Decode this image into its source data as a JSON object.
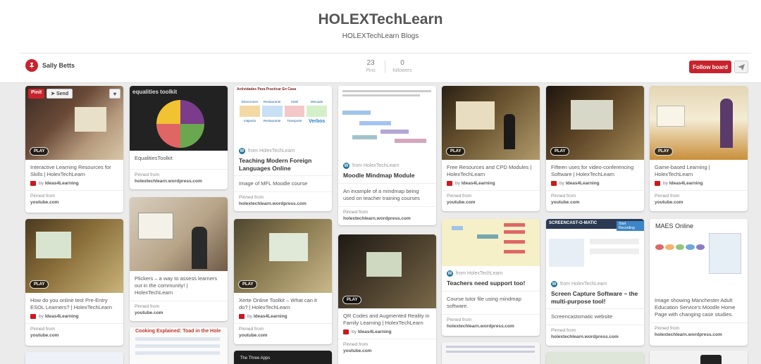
{
  "board": {
    "title": "HOLEXTechLearn",
    "subtitle": "HOLEXTechLearn Blogs",
    "owner": "Sally Betts",
    "pins_count": "23",
    "pins_label": "Pins",
    "followers_count": "0",
    "followers_label": "followers",
    "follow_label": "Follow board"
  },
  "pin_actions": {
    "pinit": "Pinit",
    "send": "Send",
    "like": "♥"
  },
  "play_label": "PLAY",
  "pinned_from_label": "Pinned from",
  "colors": {
    "accent": "#c8232c",
    "background": "#ebebeb"
  },
  "pins": [
    {
      "title": "Interactive Learning Resources for Skills | HolexTechLearn",
      "by": "Ideas4Learning",
      "source": "youtube.com"
    },
    {
      "title": "EqualitiesToolkit",
      "source": "holextechlearn.wordpress.com"
    },
    {
      "via": "from HolexTechLearn",
      "title": "Teaching Modern Foreign Languages Online",
      "desc": "Image of MFL Moodle course",
      "source": "holextechlearn.wordpress.com"
    },
    {
      "via": "from HolexTechLearn",
      "title": "Moodle Mindmap Module",
      "desc": "An example of a mindmap being used on teacher training courses",
      "source": "holextechlearn.wordpress.com"
    },
    {
      "title": "Free Resources and CPD Modules | HolexTechLearn",
      "by": "Ideas4Learning",
      "source": "youtube.com"
    },
    {
      "title": "Fifteen uses for video-conferencing Software | HolexTechLearn",
      "by": "Ideas4Learning",
      "source": "youtube.com"
    },
    {
      "title": "Game-based Learning | HolexTechLearn",
      "by": "Ideas4Learning",
      "source": "youtube.com"
    },
    {
      "title": "How do you online test Pre-Entry ESOL Learners? | HolexTechLearn",
      "by": "Ideas4Learning",
      "source": "youtube.com"
    },
    {
      "title": "Plickers – a way to assess learners out in the community! | HolexTechLearn",
      "source": "youtube.com"
    },
    {
      "title": "Xerte Online Toolkit – What can it do? | HolexTechLearn",
      "by": "Ideas4Learning",
      "source": "youtube.com"
    },
    {
      "title": "QR Codes and Augmented Reality in Family Learning | HolexTechLearn",
      "by": "Ideas4Learning",
      "source": "youtube.com"
    },
    {
      "via": "from HolexTechLearn",
      "title": "Teachers need support too!",
      "desc": "Course tutor file using mindmap software.",
      "source": "holextechlearn.wordpress.com"
    },
    {
      "via": "from HolexTechLearn",
      "title": "Screen Capture Software – the multi-purpose tool!",
      "desc": "Screencastomatic website",
      "source": "holextechlearn.wordpress.com"
    },
    {
      "desc": "Image showing Manchester Adult Education Service's Moodle Home Page with changing case studies.",
      "source": "holextechlearn.wordpress.com"
    }
  ],
  "thumb_text": {
    "eq_toolkit": "equalities toolkit",
    "mfl_heading": "Actividades Para Practicar En Casa",
    "mfl_cells": [
      "Direcciones",
      "Restaurante",
      "Hotel",
      "Mercado",
      "Viajando",
      "Restaurante",
      "Transporte",
      "Verbos"
    ],
    "screencast": "SCREENCAST-O-MATIC",
    "screencast_btn": "Start Recording",
    "maes": "MAES Online",
    "cooking": "Cooking Explained: Toad in the Hole",
    "three_apps": "The Three Apps"
  }
}
